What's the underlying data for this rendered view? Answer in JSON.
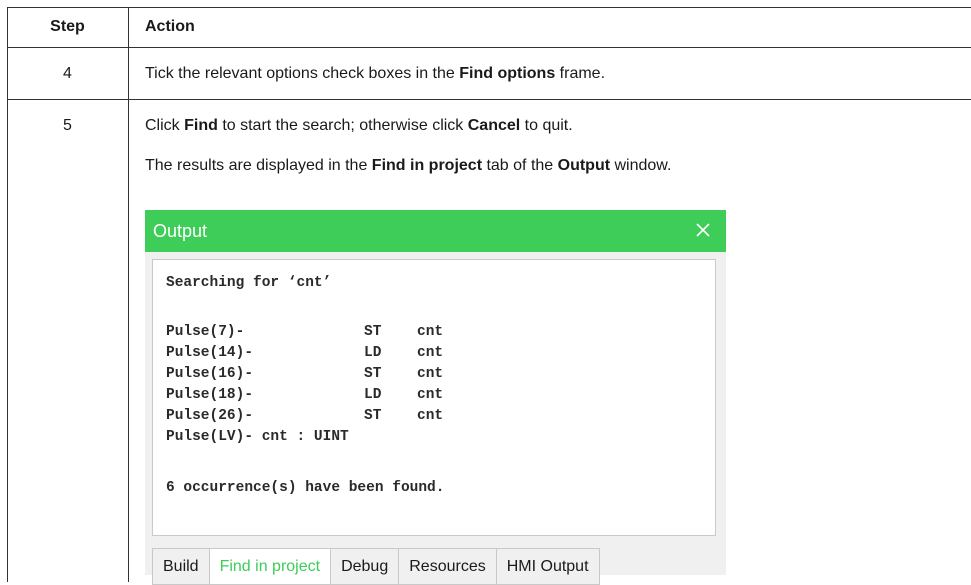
{
  "table": {
    "header": {
      "step": "Step",
      "action": "Action"
    },
    "rows": [
      {
        "step": "4",
        "action": {
          "p1": "Tick the relevant options check boxes in the ",
          "p1_bold": "Find options",
          "p1_end": " frame."
        }
      },
      {
        "step": "5",
        "action": {
          "l1_a": "Click ",
          "l1_b": "Find",
          "l1_c": " to start the search; otherwise click ",
          "l1_d": "Cancel",
          "l1_e": " to quit.",
          "l2_a": "The results are displayed in the ",
          "l2_b": "Find in project",
          "l2_c": " tab of the ",
          "l2_d": "Output",
          "l2_e": " window."
        }
      }
    ]
  },
  "output_window": {
    "title": "Output",
    "close_icon": "close-icon",
    "accent_color": "#3dcd58",
    "lines": {
      "searching": "Searching for ‘cnt’",
      "results": [
        {
          "name": "Pulse(7)-",
          "op": "ST",
          "var": "cnt"
        },
        {
          "name": "Pulse(14)-",
          "op": "LD",
          "var": "cnt"
        },
        {
          "name": "Pulse(16)-",
          "op": "ST",
          "var": "cnt"
        },
        {
          "name": "Pulse(18)-",
          "op": "LD",
          "var": "cnt"
        },
        {
          "name": "Pulse(26)-",
          "op": "ST",
          "var": "cnt"
        }
      ],
      "declaration": "Pulse(LV)- cnt : UINT",
      "summary": "6 occurrence(s) have been found."
    },
    "tabs": [
      "Build",
      "Find in project",
      "Debug",
      "Resources",
      "HMI Output"
    ],
    "active_tab": "Find in project"
  }
}
